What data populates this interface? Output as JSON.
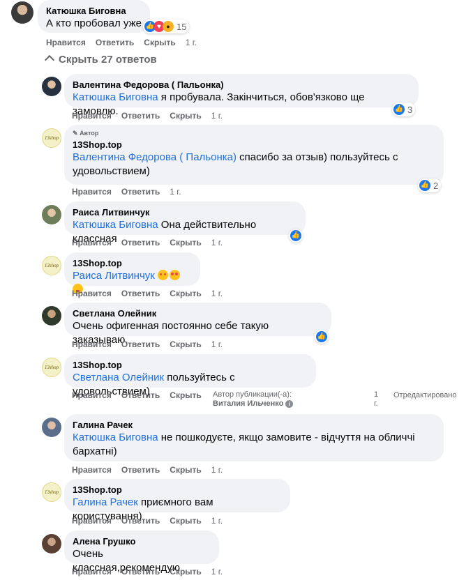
{
  "top": {
    "name": "Катюшка Биговна",
    "text": "А кто пробовал уже",
    "reactions": "15",
    "actions": {
      "like": "Нравится",
      "reply": "Ответить",
      "hide": "Скрыть",
      "time": "1 г."
    }
  },
  "hide_replies": "Скрыть 27 ответов",
  "replies": [
    {
      "name": "Валентина Федорова ( Пальонка)",
      "mention": "Катюшка Биговна",
      "text": " я пробувала. Закінчиться, обов'язково ще замовлю.",
      "reactions": "3",
      "actions": {
        "like": "Нравится",
        "reply": "Ответить",
        "hide": "Скрыть",
        "time": "1 г."
      }
    },
    {
      "badge": "Автор",
      "name": "13Shop.top",
      "mention": "Валентина Федорова ( Пальонка)",
      "text": " спасибо за отзыв) пользуйтесь с удовольствием)",
      "reactions": "2",
      "actions": {
        "like": "Нравится",
        "reply": "Ответить",
        "time": "1 г."
      }
    },
    {
      "name": "Раиса Литвинчук",
      "mention": "Катюшка Биговна",
      "text": " Она действительно классная",
      "actions": {
        "like": "Нравится",
        "reply": "Ответить",
        "hide": "Скрыть",
        "time": "1 г."
      }
    },
    {
      "name": "13Shop.top",
      "mention": "Раиса Литвинчук",
      "text": "",
      "actions": {
        "like": "Нравится",
        "reply": "Ответить",
        "hide": "Скрыть",
        "time": "1 г."
      }
    },
    {
      "name": "Светлана Олейник",
      "text": "Очень офигенная постоянно себе такую заказываю.",
      "actions": {
        "like": "Нравится",
        "reply": "Ответить",
        "hide": "Скрыть",
        "time": "1 г."
      }
    },
    {
      "name": "13Shop.top",
      "mention": "Светлана Олейник",
      "text": " пользуйтесь с удовольствием)",
      "actions": {
        "like": "Нравится",
        "reply": "Ответить",
        "hide": "Скрыть",
        "author_note": "Автор публикации(-а):",
        "author_name": "Виталия Ильченко",
        "time_a": "1",
        "time_b": "г.",
        "edited": "Отредактировано"
      }
    },
    {
      "name": "Галина Рачек",
      "mention": "Катюшка Биговна",
      "text": " не пошкодуєте, якщо замовите - відчуття на обличчі бархатні)",
      "actions": {
        "like": "Нравится",
        "reply": "Ответить",
        "hide": "Скрыть",
        "time": "1 г."
      }
    },
    {
      "name": "13Shop.top",
      "mention": "Галина Рачек",
      "text": " приємного вам користування)",
      "actions": {
        "like": "Нравится",
        "reply": "Ответить",
        "hide": "Скрыть",
        "time": "1 г."
      }
    },
    {
      "name": "Алена Грушко",
      "text": "Очень классная,рекомендую",
      "actions": {
        "like": "Нравится",
        "reply": "Ответить",
        "hide": "Скрыть",
        "time": "1 г."
      }
    }
  ],
  "shop_avatar_text": "13shop",
  "colors": {
    "link": "#216fdb",
    "muted": "#65676b",
    "bubble": "#f0f2f5",
    "like": "#1877f2"
  }
}
